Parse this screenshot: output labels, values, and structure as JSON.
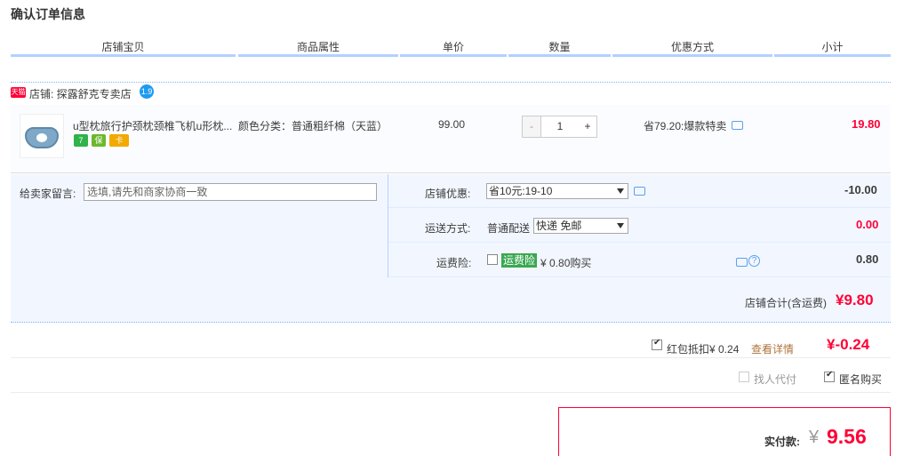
{
  "page": {
    "title": "确认订单信息"
  },
  "table_headers": [
    "店铺宝贝",
    "商品属性",
    "单价",
    "数量",
    "优惠方式",
    "小计"
  ],
  "shop": {
    "badge": "天猫",
    "label": "店铺: 探露舒克专卖店",
    "ww_badge": "1.9"
  },
  "item": {
    "name": "u型枕旅行护颈枕颈椎飞机u形枕...",
    "service_icons": [
      {
        "name": "7-day-return-icon",
        "text": "7",
        "color": "#2fb34a"
      },
      {
        "name": "guarantee-icon",
        "text": "保",
        "color": "#6bb82e"
      },
      {
        "name": "card-icon",
        "text": "卡",
        "color": "#f2a900"
      }
    ],
    "attr": "颜色分类：普通粗纤棉（天蓝）",
    "price": "99.00",
    "qty": {
      "minus": "-",
      "value": "1",
      "plus": "+"
    },
    "promo": "省79.20:爆款特卖",
    "subtotal": "19.80"
  },
  "options": {
    "message_label": "给卖家留言:",
    "message_placeholder": "选填,请先和商家协商一致",
    "shop_coupon_label": "店铺优惠:",
    "shop_coupon_value": "省10元:19-10",
    "shop_coupon_amount": "-10.00",
    "shipping_label": "运送方式:",
    "shipping_type": "普通配送",
    "shipping_value": "快递 免邮",
    "shipping_amount": "0.00",
    "insurance_label": "运费险:",
    "insurance_tag": "运费险",
    "insurance_price": "¥ 0.80购买",
    "insurance_amount": "0.80"
  },
  "shop_total": {
    "label": "店铺合计(含运费)",
    "amount": "¥9.80"
  },
  "redpacket": {
    "label": "红包抵扣¥ 0.24",
    "link": "查看详情",
    "amount": "¥-0.24"
  },
  "daifu": {
    "label": "找人代付"
  },
  "anon": {
    "label": "匿名购买"
  },
  "payment": {
    "label": "实付款:",
    "currency": "¥",
    "amount": "9.56"
  }
}
